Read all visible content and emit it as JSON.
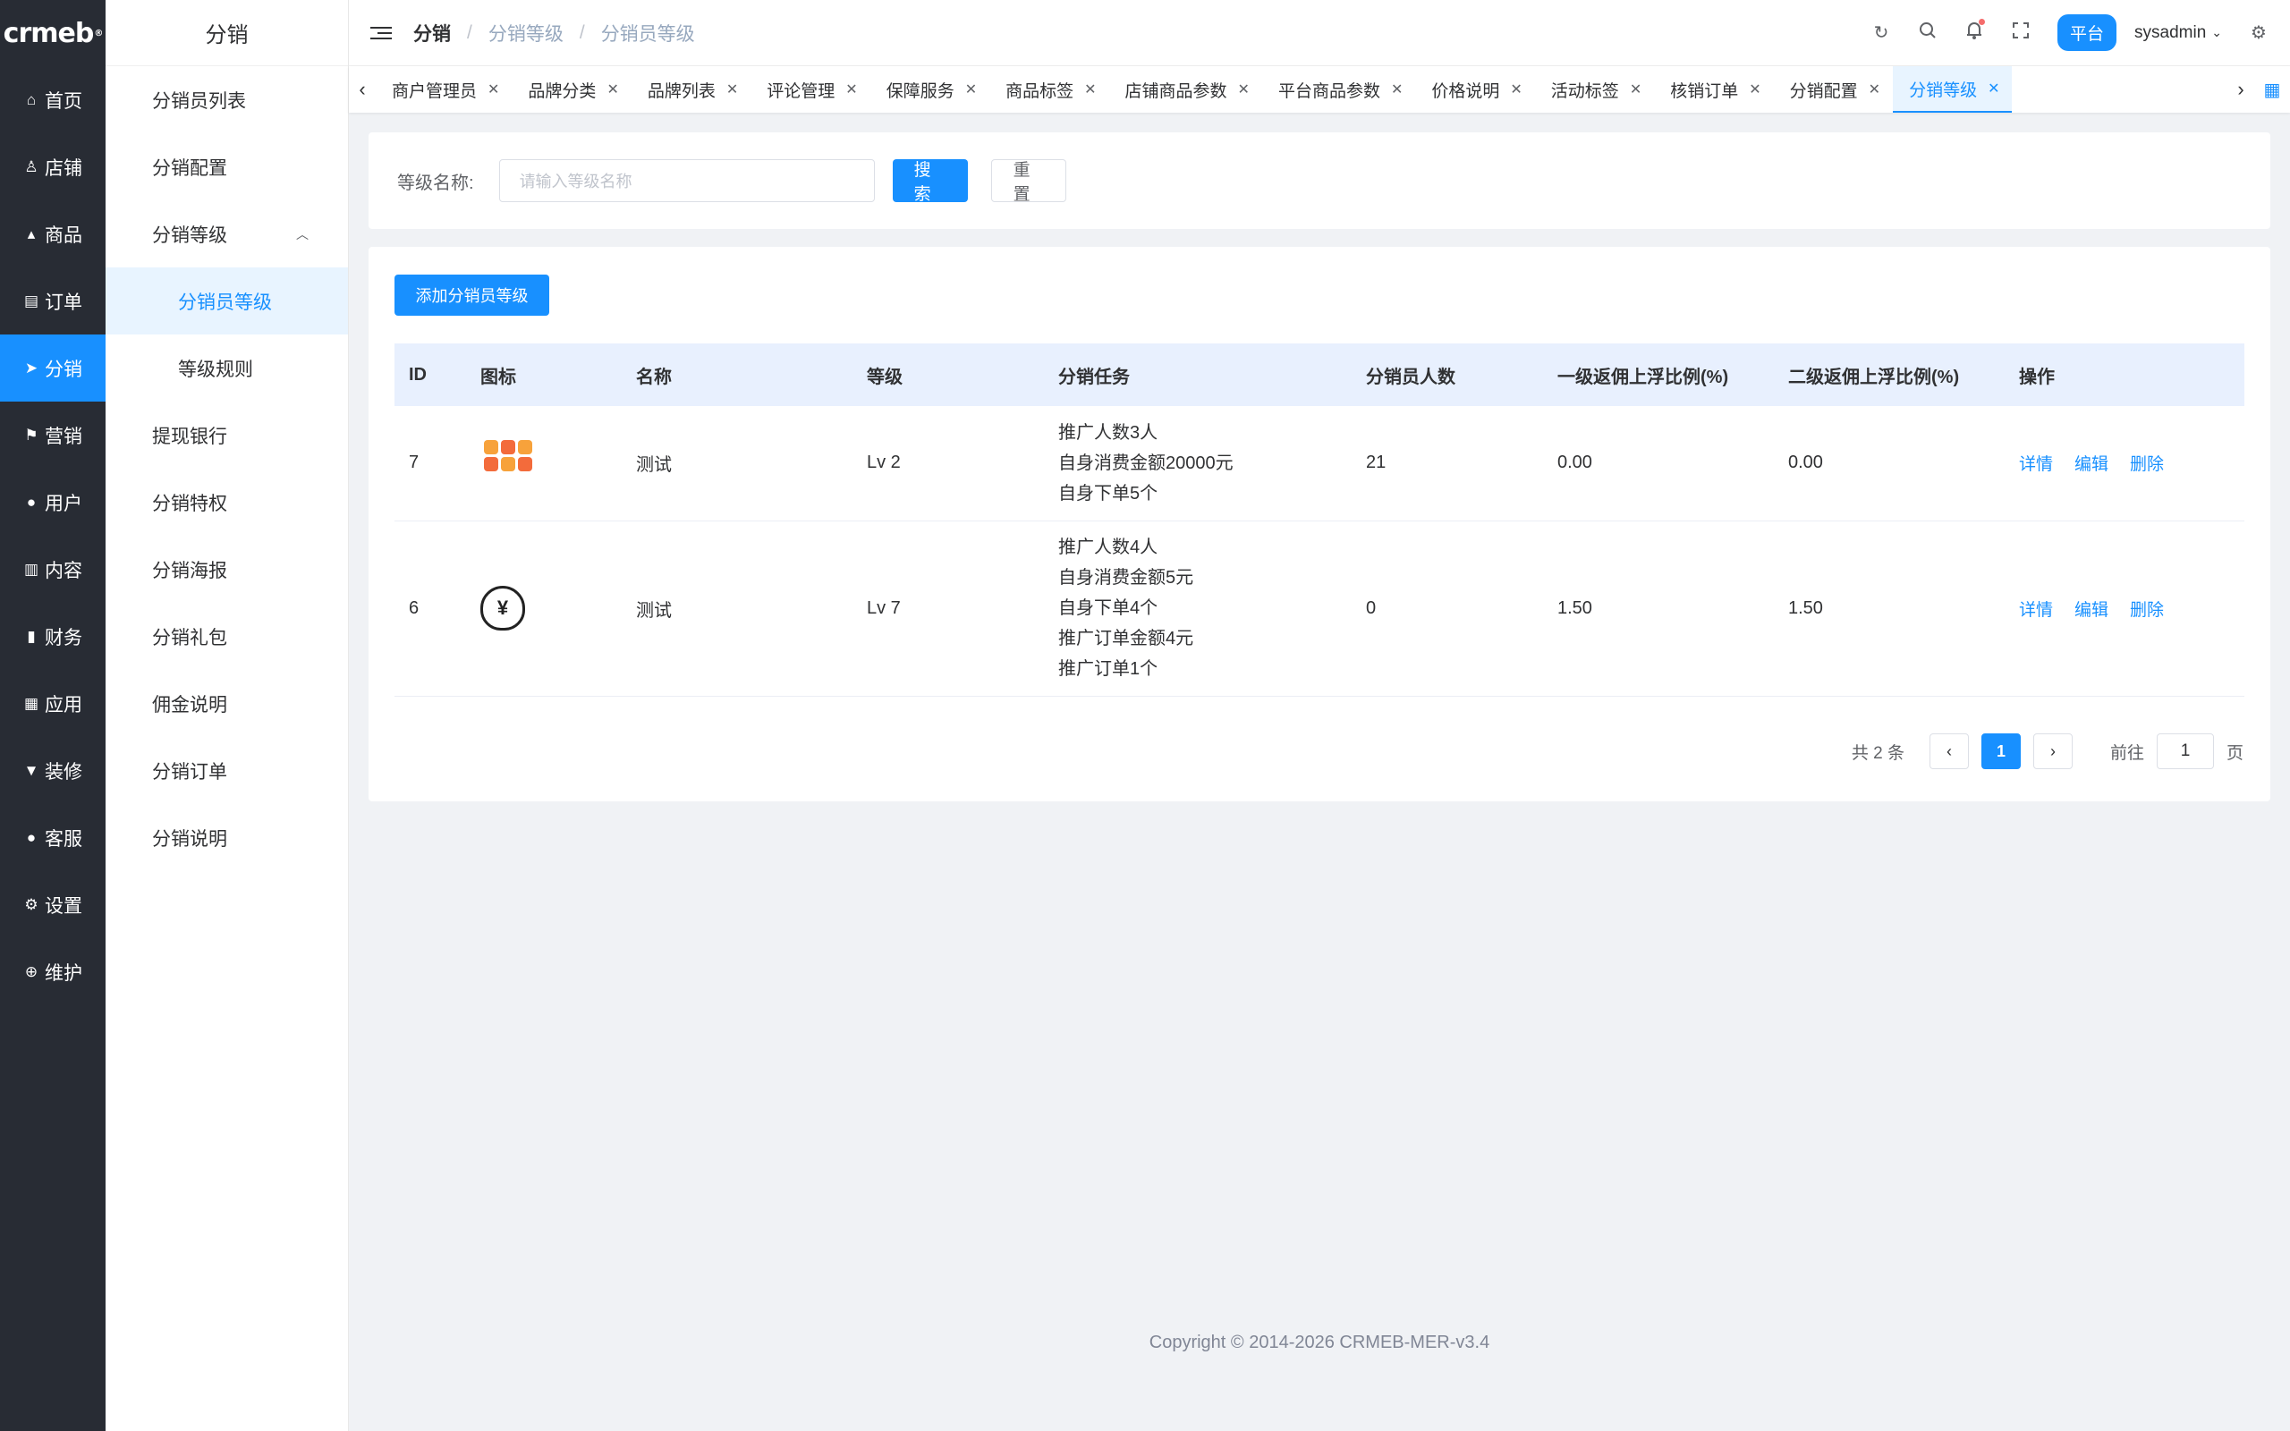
{
  "rail": {
    "logo": "crmeb",
    "items": [
      {
        "label": "首页",
        "icon": "home-icon",
        "glyph": "⌂"
      },
      {
        "label": "店铺",
        "icon": "user-outline-icon",
        "glyph": "♙"
      },
      {
        "label": "商品",
        "icon": "bag-icon",
        "glyph": "▴"
      },
      {
        "label": "订单",
        "icon": "clipboard-icon",
        "glyph": "▤"
      },
      {
        "label": "分销",
        "icon": "paper-plane-icon",
        "glyph": "➤",
        "active": true
      },
      {
        "label": "营销",
        "icon": "flag-icon",
        "glyph": "⚑"
      },
      {
        "label": "用户",
        "icon": "user-icon",
        "glyph": "●"
      },
      {
        "label": "内容",
        "icon": "book-icon",
        "glyph": "▥"
      },
      {
        "label": "财务",
        "icon": "bar-chart-icon",
        "glyph": "▮"
      },
      {
        "label": "应用",
        "icon": "grid-icon",
        "glyph": "▦"
      },
      {
        "label": "装修",
        "icon": "brush-icon",
        "glyph": "▼"
      },
      {
        "label": "客服",
        "icon": "service-icon",
        "glyph": "●"
      },
      {
        "label": "设置",
        "icon": "gear-icon",
        "glyph": "⚙"
      },
      {
        "label": "维护",
        "icon": "plus-circle-icon",
        "glyph": "⊕"
      }
    ]
  },
  "sidebar": {
    "title": "分销",
    "items": [
      {
        "label": "分销员列表"
      },
      {
        "label": "分销配置"
      },
      {
        "label": "分销等级",
        "expanded": true
      },
      {
        "label": "分销员等级",
        "sub": true,
        "active": true
      },
      {
        "label": "等级规则",
        "sub": true
      },
      {
        "label": "提现银行"
      },
      {
        "label": "分销特权"
      },
      {
        "label": "分销海报"
      },
      {
        "label": "分销礼包"
      },
      {
        "label": "佣金说明"
      },
      {
        "label": "分销订单"
      },
      {
        "label": "分销说明"
      }
    ]
  },
  "header": {
    "breadcrumb": [
      "分销",
      "分销等级",
      "分销员等级"
    ],
    "platform": "平台",
    "user": "sysadmin"
  },
  "tags": [
    "商户管理员",
    "品牌分类",
    "品牌列表",
    "评论管理",
    "保障服务",
    "商品标签",
    "店铺商品参数",
    "平台商品参数",
    "价格说明",
    "活动标签",
    "核销订单",
    "分销配置",
    "分销等级"
  ],
  "search": {
    "label": "等级名称:",
    "placeholder": "请输入等级名称",
    "search_label": "搜索",
    "reset_label": "重置"
  },
  "table": {
    "add_label": "添加分销员等级",
    "columns": [
      "ID",
      "图标",
      "名称",
      "等级",
      "分销任务",
      "分销员人数",
      "一级返佣上浮比例(%)",
      "二级返佣上浮比例(%)",
      "操作"
    ],
    "rows": [
      {
        "id": "7",
        "icon": "badges-image-icon",
        "name": "测试",
        "level": "Lv 2",
        "tasks": [
          "推广人数3人",
          "自身消费金额20000元",
          "自身下单5个"
        ],
        "count": "21",
        "rate1": "0.00",
        "rate2": "0.00"
      },
      {
        "id": "6",
        "icon": "money-bag-icon",
        "name": "测试",
        "level": "Lv 7",
        "tasks": [
          "推广人数4人",
          "自身消费金额5元",
          "自身下单4个",
          "推广订单金额4元",
          "推广订单1个"
        ],
        "count": "0",
        "rate1": "1.50",
        "rate2": "1.50"
      }
    ],
    "ops": [
      "详情",
      "编辑",
      "删除"
    ]
  },
  "pagination": {
    "total": "共 2 条",
    "current": "1",
    "goto_label": "前往",
    "goto_value": "1",
    "page_unit": "页"
  },
  "footer": {
    "copyright": "Copyright © 2014-2026 CRMEB-MER-v3.4"
  }
}
